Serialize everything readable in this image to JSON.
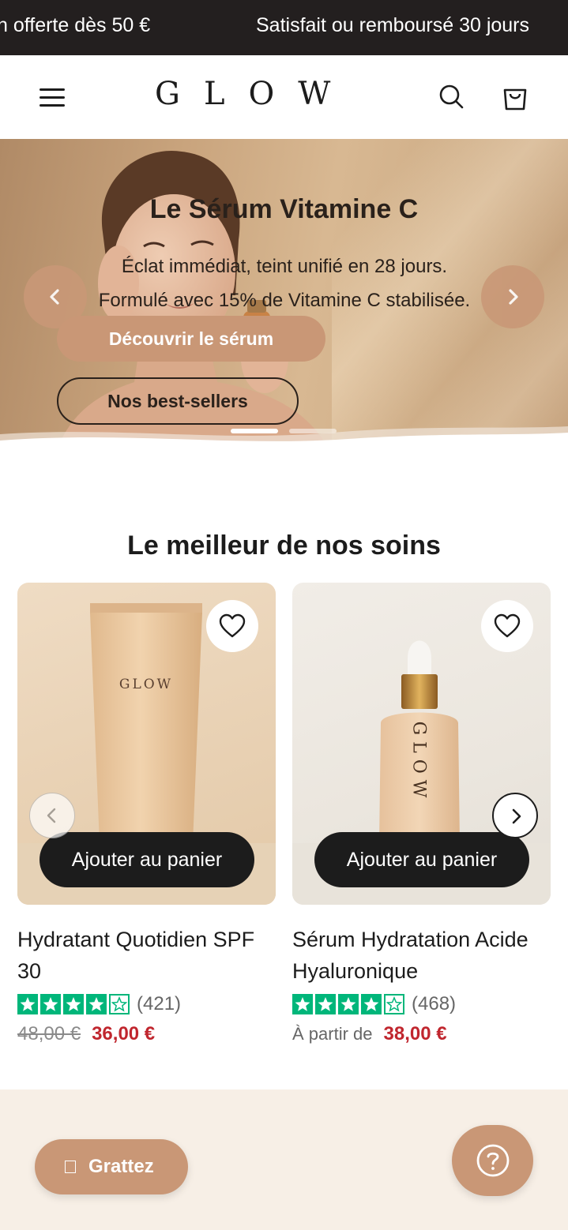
{
  "announcement": {
    "messages": [
      "n offerte dès 50 €",
      "Satisfait ou remboursé 30 jours"
    ]
  },
  "header": {
    "logo": "GLOW",
    "icons": [
      "menu-icon",
      "search-icon",
      "cart-icon"
    ]
  },
  "hero": {
    "title": "Le Sérum Vitamine C",
    "subtitle_line1": "Éclat immédiat, teint unifié en 28 jours.",
    "subtitle_line2": "Formulé avec 15% de Vitamine C stabilisée.",
    "primary_button": "Découvrir le sérum",
    "secondary_button": "Nos best-sellers",
    "slide_count": 2,
    "active_slide": 1,
    "accent_color": "#c99776"
  },
  "products_section": {
    "title": "Le meilleur de nos soins",
    "products": [
      {
        "name": "Hydratant Quotidien SPF 30",
        "add_to_cart": "Ajouter au panier",
        "rating_count": "(421)",
        "old_price": "48,00 €",
        "price": "36,00 €",
        "image_brand": "GLOW"
      },
      {
        "name": "Sérum Hydratation Acide Hyaluronique",
        "add_to_cart": "Ajouter au panier",
        "rating_count": "(468)",
        "price_prefix": "À partir de",
        "price": "38,00 €",
        "image_brand": "GLOW"
      }
    ]
  },
  "floating": {
    "scratch_button": "Grattez",
    "help_icon": "question-icon"
  },
  "colors": {
    "announcement_bg": "#231f1f",
    "sale_price": "#c0262e",
    "rating_green": "#00b67a"
  }
}
